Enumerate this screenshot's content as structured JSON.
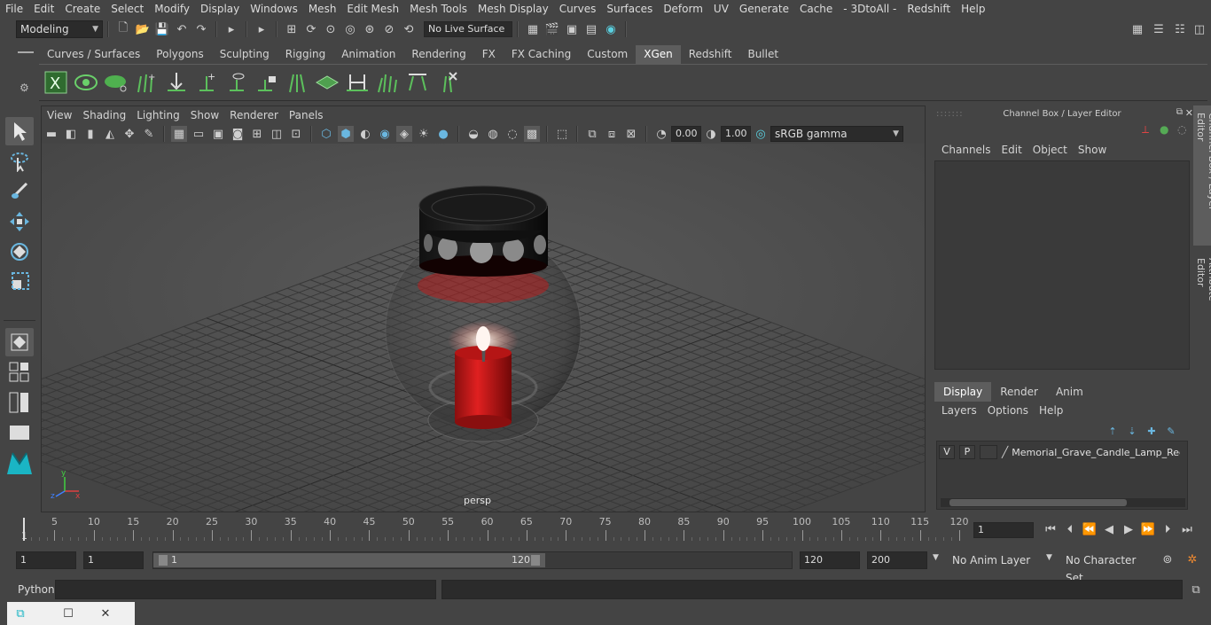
{
  "menubar": {
    "items": [
      "File",
      "Edit",
      "Create",
      "Select",
      "Modify",
      "Display",
      "Windows",
      "Mesh",
      "Edit Mesh",
      "Mesh Tools",
      "Mesh Display",
      "Curves",
      "Surfaces",
      "Deform",
      "UV",
      "Generate",
      "Cache",
      "- 3DtoAll -",
      "Redshift",
      "Help"
    ]
  },
  "statusline": {
    "mode": "Modeling",
    "live_surface": "No Live Surface"
  },
  "shelf": {
    "tabs": [
      "Curves / Surfaces",
      "Polygons",
      "Sculpting",
      "Rigging",
      "Animation",
      "Rendering",
      "FX",
      "FX Caching",
      "Custom",
      "XGen",
      "Redshift",
      "Bullet"
    ],
    "active_tab": "XGen"
  },
  "viewport": {
    "menu": [
      "View",
      "Shading",
      "Lighting",
      "Show",
      "Renderer",
      "Panels"
    ],
    "exposure": "0.00",
    "gamma": "1.00",
    "color_space": "sRGB gamma",
    "camera_label": "persp"
  },
  "right_panel": {
    "title": "Channel Box / Layer Editor",
    "cb_menu": [
      "Channels",
      "Edit",
      "Object",
      "Show"
    ],
    "layer_tabs": [
      "Display",
      "Render",
      "Anim"
    ],
    "layer_menu": [
      "Layers",
      "Options",
      "Help"
    ],
    "layer": {
      "v": "V",
      "p": "P",
      "name": "Memorial_Grave_Candle_Lamp_Red_l"
    },
    "side_tabs": [
      "Channel Box / Layer Editor",
      "Attribute Editor"
    ]
  },
  "timeline": {
    "ticks": [
      5,
      10,
      15,
      20,
      25,
      30,
      35,
      40,
      45,
      50,
      55,
      60,
      65,
      70,
      75,
      80,
      85,
      90,
      95,
      100,
      105,
      110,
      115,
      120
    ],
    "start_label": "1",
    "current_frame": "1"
  },
  "range": {
    "start": "1",
    "playback_start": "1",
    "slider_start": "1",
    "slider_end": "120",
    "playback_end": "120",
    "end": "200",
    "anim_layer": "No Anim Layer",
    "character_set": "No Character Set"
  },
  "cmdline": {
    "label": "Python"
  }
}
